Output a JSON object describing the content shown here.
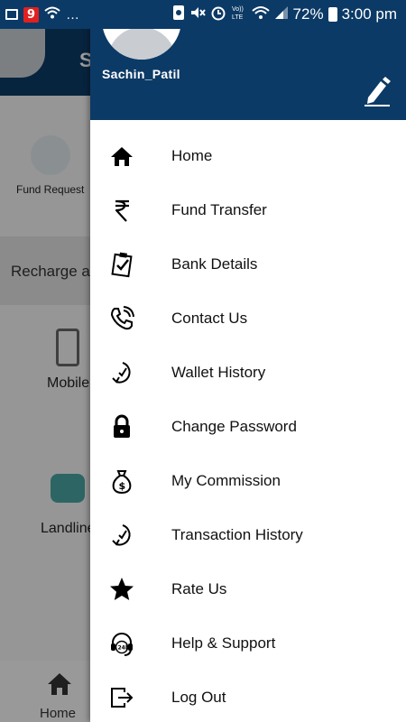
{
  "status_bar": {
    "badge_number": "9",
    "overflow": "…",
    "battery_percent": "72%",
    "time": "3:00 pm",
    "network_label": "Vo)) LTE"
  },
  "background": {
    "header_initial": "S",
    "fund_request_label": "Fund Request",
    "recharge_label": "Recharge a",
    "mobile_label": "Mobile",
    "landline_label": "Landline",
    "home_label": "Home"
  },
  "drawer": {
    "username": "Sachin_Patil",
    "items": [
      {
        "label": "Home",
        "icon": "home-icon"
      },
      {
        "label": "Fund Transfer",
        "icon": "rupee-icon"
      },
      {
        "label": "Bank Details",
        "icon": "clipboard-check-icon"
      },
      {
        "label": "Contact Us",
        "icon": "phone-call-icon"
      },
      {
        "label": "Wallet History",
        "icon": "history-icon"
      },
      {
        "label": "Change Password",
        "icon": "lock-icon"
      },
      {
        "label": "My Commission",
        "icon": "money-bag-icon"
      },
      {
        "label": "Transaction History",
        "icon": "history-icon"
      },
      {
        "label": "Rate Us",
        "icon": "star-icon"
      },
      {
        "label": "Help & Support",
        "icon": "headset-24h-icon"
      },
      {
        "label": "Log Out",
        "icon": "logout-icon"
      }
    ]
  },
  "colors": {
    "primary": "#0c3a66",
    "scrim": "rgba(0,0,0,0.38)"
  }
}
